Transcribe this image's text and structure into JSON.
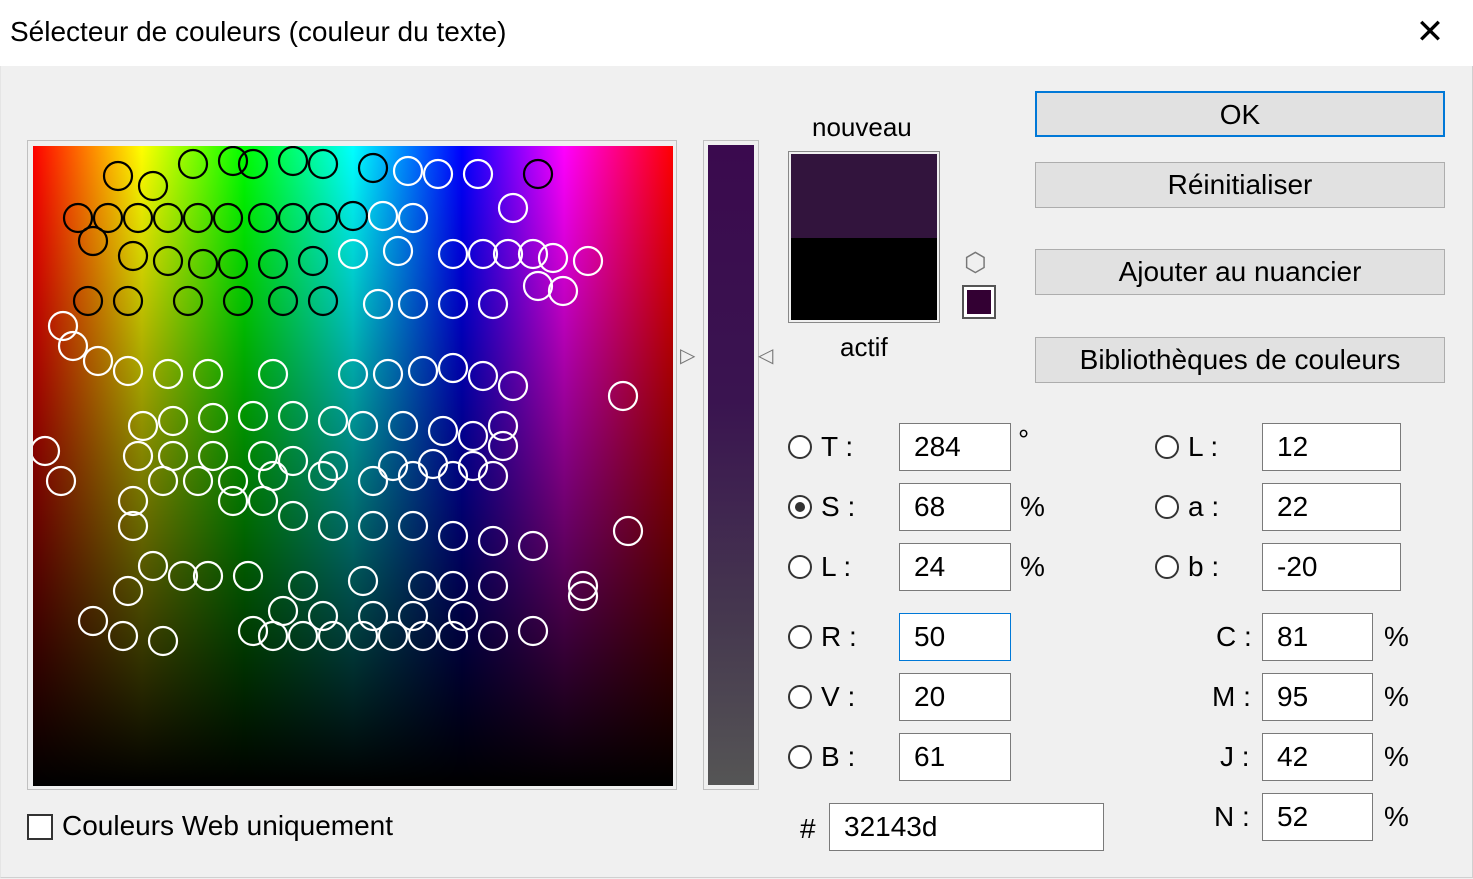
{
  "window": {
    "title": "Sélecteur de couleurs (couleur du texte)",
    "close_glyph": "✕"
  },
  "preview": {
    "new_label": "nouveau",
    "current_label": "actif",
    "new_color": "#32143d",
    "current_color": "#000000"
  },
  "buttons": {
    "ok": "OK",
    "reset": "Réinitialiser",
    "add_swatch": "Ajouter au nuancier",
    "libraries": "Bibliothèques de couleurs"
  },
  "hsb": [
    {
      "label": "T :",
      "value": "284",
      "unit": "°",
      "selected": false
    },
    {
      "label": "S :",
      "value": "68",
      "unit": "%",
      "selected": true
    },
    {
      "label": "L :",
      "value": "24",
      "unit": "%",
      "selected": false
    }
  ],
  "rgb": [
    {
      "label": "R :",
      "value": "50"
    },
    {
      "label": "V :",
      "value": "20"
    },
    {
      "label": "B :",
      "value": "61"
    }
  ],
  "lab": [
    {
      "label": "L :",
      "value": "12"
    },
    {
      "label": "a :",
      "value": "22"
    },
    {
      "label": "b :",
      "value": "-20"
    }
  ],
  "cmyk": [
    {
      "label": "C :",
      "value": "81",
      "unit": "%"
    },
    {
      "label": "M :",
      "value": "95",
      "unit": "%"
    },
    {
      "label": "J :",
      "value": "42",
      "unit": "%"
    },
    {
      "label": "N :",
      "value": "52",
      "unit": "%"
    }
  ],
  "hex": {
    "label": "#",
    "value": "32143d"
  },
  "web_only": {
    "label": "Couleurs Web uniquement",
    "checked": false
  },
  "icons": {
    "gamut": "cube-icon",
    "arrows": "triangle-arrow-icon"
  }
}
